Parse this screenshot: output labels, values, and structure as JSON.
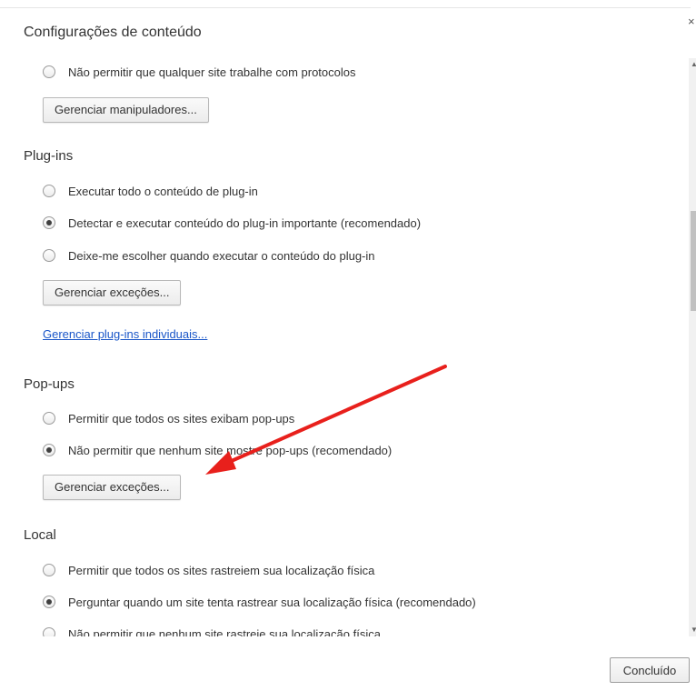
{
  "dialog": {
    "title": "Configurações de conteúdo",
    "close_icon": "×",
    "done_label": "Concluído"
  },
  "handlers": {
    "radio_block": "Não permitir que qualquer site trabalhe com protocolos",
    "block_selected": false,
    "manage_label": "Gerenciar manipuladores..."
  },
  "plugins": {
    "title": "Plug-ins",
    "options": [
      {
        "label": "Executar todo o conteúdo de plug-in",
        "selected": false
      },
      {
        "label": "Detectar e executar conteúdo do plug-in importante (recomendado)",
        "selected": true
      },
      {
        "label": "Deixe-me escolher quando executar o conteúdo do plug-in",
        "selected": false
      }
    ],
    "manage_label": "Gerenciar exceções...",
    "individual_link": "Gerenciar plug-ins individuais..."
  },
  "popups": {
    "title": "Pop-ups",
    "options": [
      {
        "label": "Permitir que todos os sites exibam pop-ups",
        "selected": false
      },
      {
        "label": "Não permitir que nenhum site mostre pop-ups (recomendado)",
        "selected": true
      }
    ],
    "manage_label": "Gerenciar exceções..."
  },
  "location": {
    "title": "Local",
    "options": [
      {
        "label": "Permitir que todos os sites rastreiem sua localização física",
        "selected": false
      },
      {
        "label": "Perguntar quando um site tenta rastrear sua localização física (recomendado)",
        "selected": true
      },
      {
        "label": "Não permitir que nenhum site rastreie sua localização física",
        "selected": false
      }
    ]
  },
  "annotation": {
    "arrow_color": "#e8201c"
  },
  "icons": {
    "scroll_up": "▲",
    "scroll_down": "▼"
  }
}
